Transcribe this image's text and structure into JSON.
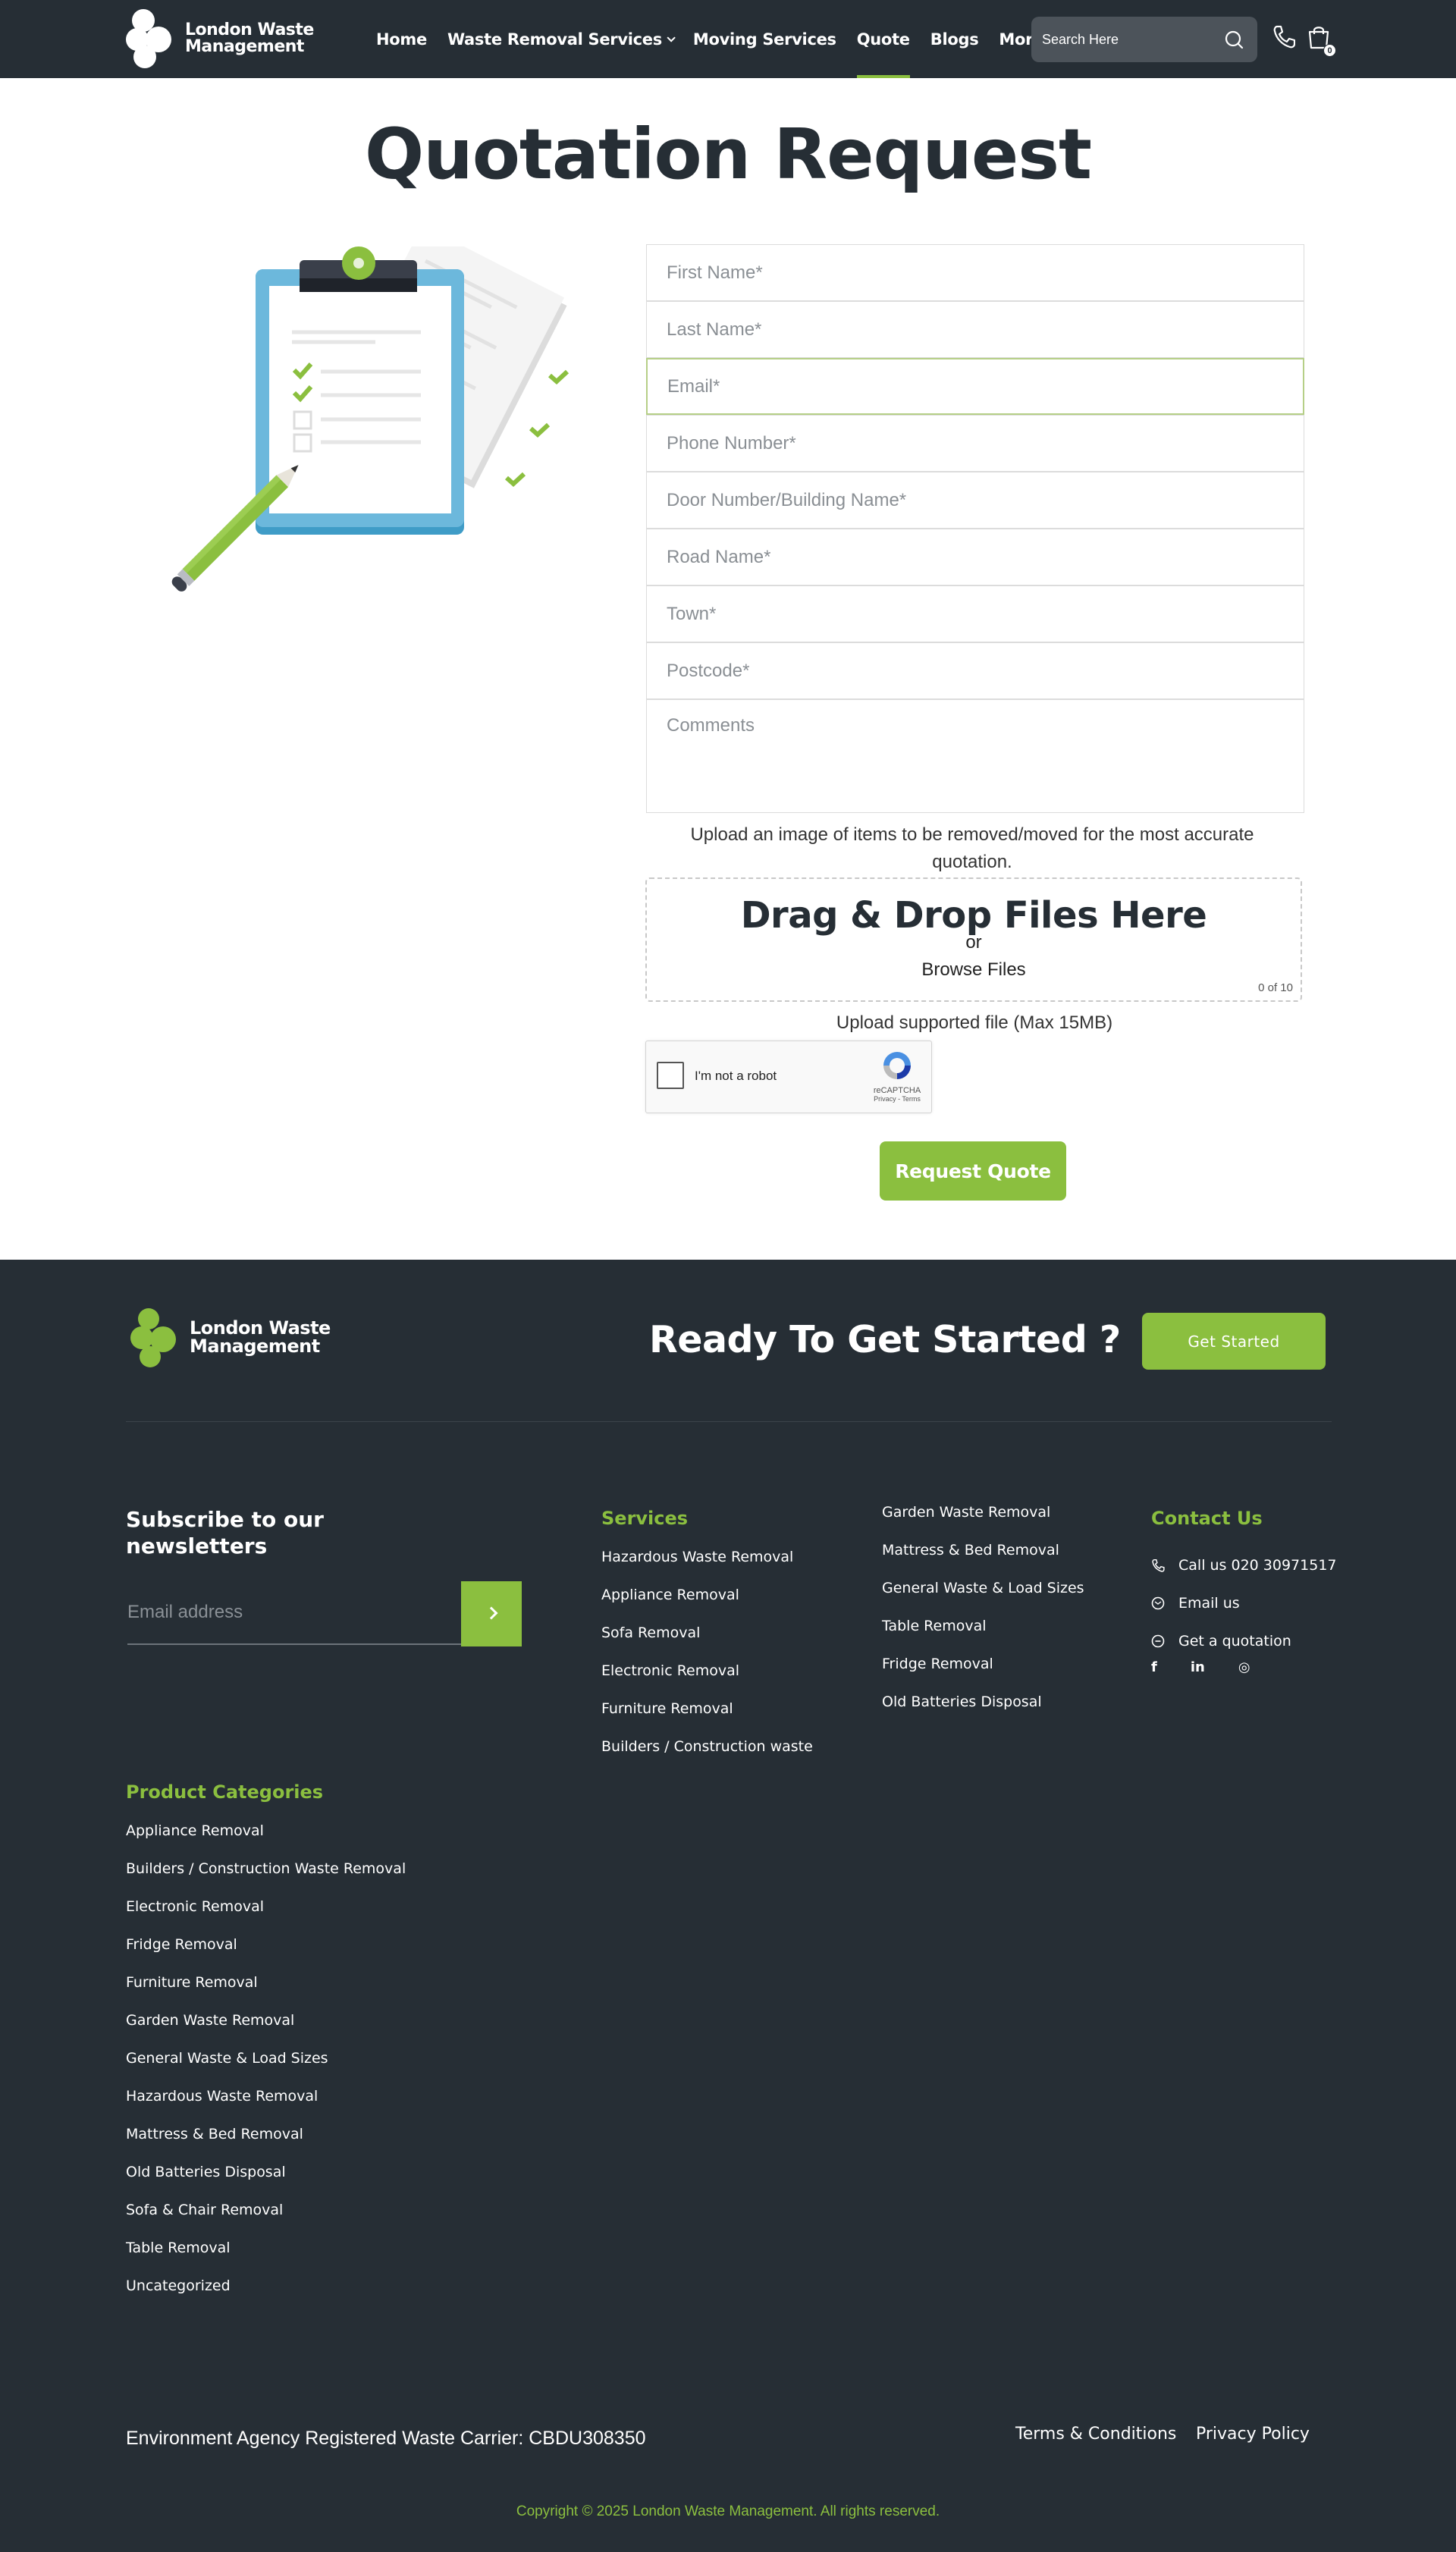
{
  "brand": {
    "name_line1": "London Waste",
    "name_line2": "Management"
  },
  "nav": {
    "items": [
      {
        "label": "Home",
        "has_dropdown": false,
        "active": false
      },
      {
        "label": "Waste Removal Services",
        "has_dropdown": true,
        "active": false
      },
      {
        "label": "Moving Services",
        "has_dropdown": false,
        "active": false
      },
      {
        "label": "Quote",
        "has_dropdown": false,
        "active": true
      },
      {
        "label": "Blogs",
        "has_dropdown": false,
        "active": false
      },
      {
        "label": "More",
        "has_dropdown": true,
        "active": false
      }
    ],
    "search_placeholder": "Search Here",
    "cart_count": "0"
  },
  "page": {
    "title": "Quotation Request",
    "form": {
      "fields": [
        {
          "placeholder": "First Name*",
          "value": ""
        },
        {
          "placeholder": "Last Name*",
          "value": ""
        },
        {
          "placeholder": "Email*",
          "value": "",
          "focused": true
        },
        {
          "placeholder": "Phone Number*",
          "value": ""
        },
        {
          "placeholder": "Door Number/Building Name*",
          "value": ""
        },
        {
          "placeholder": "Road Name*",
          "value": ""
        },
        {
          "placeholder": "Town*",
          "value": ""
        },
        {
          "placeholder": "Postcode*",
          "value": ""
        }
      ],
      "comments_placeholder": "Comments",
      "upload_note": "Upload an image of items to be removed/moved for the most accurate quotation.",
      "dropzone": {
        "title": "Drag & Drop Files Here",
        "or": "or",
        "browse": "Browse Files",
        "count": "0 of 10"
      },
      "upload_support": "Upload supported file (Max 15MB)",
      "captcha": {
        "label": "I'm not a robot",
        "brand": "reCAPTCHA",
        "links": "Privacy - Terms"
      },
      "submit_label": "Request Quote"
    }
  },
  "footer": {
    "cta_title": "Ready To Get Started ?",
    "cta_button": "Get Started",
    "subscribe_title": "Subscribe to our newsletters",
    "subscribe_placeholder": "Email address",
    "services_title": "Services",
    "services_col1": [
      "Hazardous Waste Removal",
      "Appliance Removal",
      "Sofa Removal",
      "Electronic Removal",
      "Furniture Removal",
      "Builders / Construction waste"
    ],
    "services_col2": [
      "Garden Waste Removal",
      "Mattress & Bed Removal",
      "General Waste & Load Sizes",
      "Table Removal",
      "Fridge Removal",
      "Old Batteries Disposal"
    ],
    "contact_title": "Contact Us",
    "contact_items": [
      {
        "icon": "phone-icon",
        "label": "Call us 020 30971517"
      },
      {
        "icon": "email-icon",
        "label": "Email us"
      },
      {
        "icon": "chat-icon",
        "label": "Get a quotation"
      }
    ],
    "socials": [
      {
        "icon": "facebook-icon",
        "glyph": "f"
      },
      {
        "icon": "linkedin-icon",
        "glyph": "in"
      },
      {
        "icon": "instagram-icon",
        "glyph": "◎"
      }
    ],
    "categories_title": "Product Categories",
    "categories": [
      "Appliance Removal",
      "Builders / Construction Waste Removal",
      "Electronic Removal",
      "Fridge Removal",
      "Furniture Removal",
      "Garden Waste Removal",
      "General Waste & Load Sizes",
      "Hazardous Waste Removal",
      "Mattress & Bed Removal",
      "Old Batteries Disposal",
      "Sofa & Chair Removal",
      "Table Removal",
      "Uncategorized"
    ],
    "carrier": "Environment Agency Registered Waste Carrier: CBDU308350",
    "terms": "Terms & Conditions",
    "privacy": "Privacy Policy",
    "copyright": "Copyright © 2025 London Waste Management. All rights reserved."
  },
  "colors": {
    "header_bg": "#262e35",
    "accent": "#8bbf3f",
    "footer_bg": "#262e35"
  }
}
